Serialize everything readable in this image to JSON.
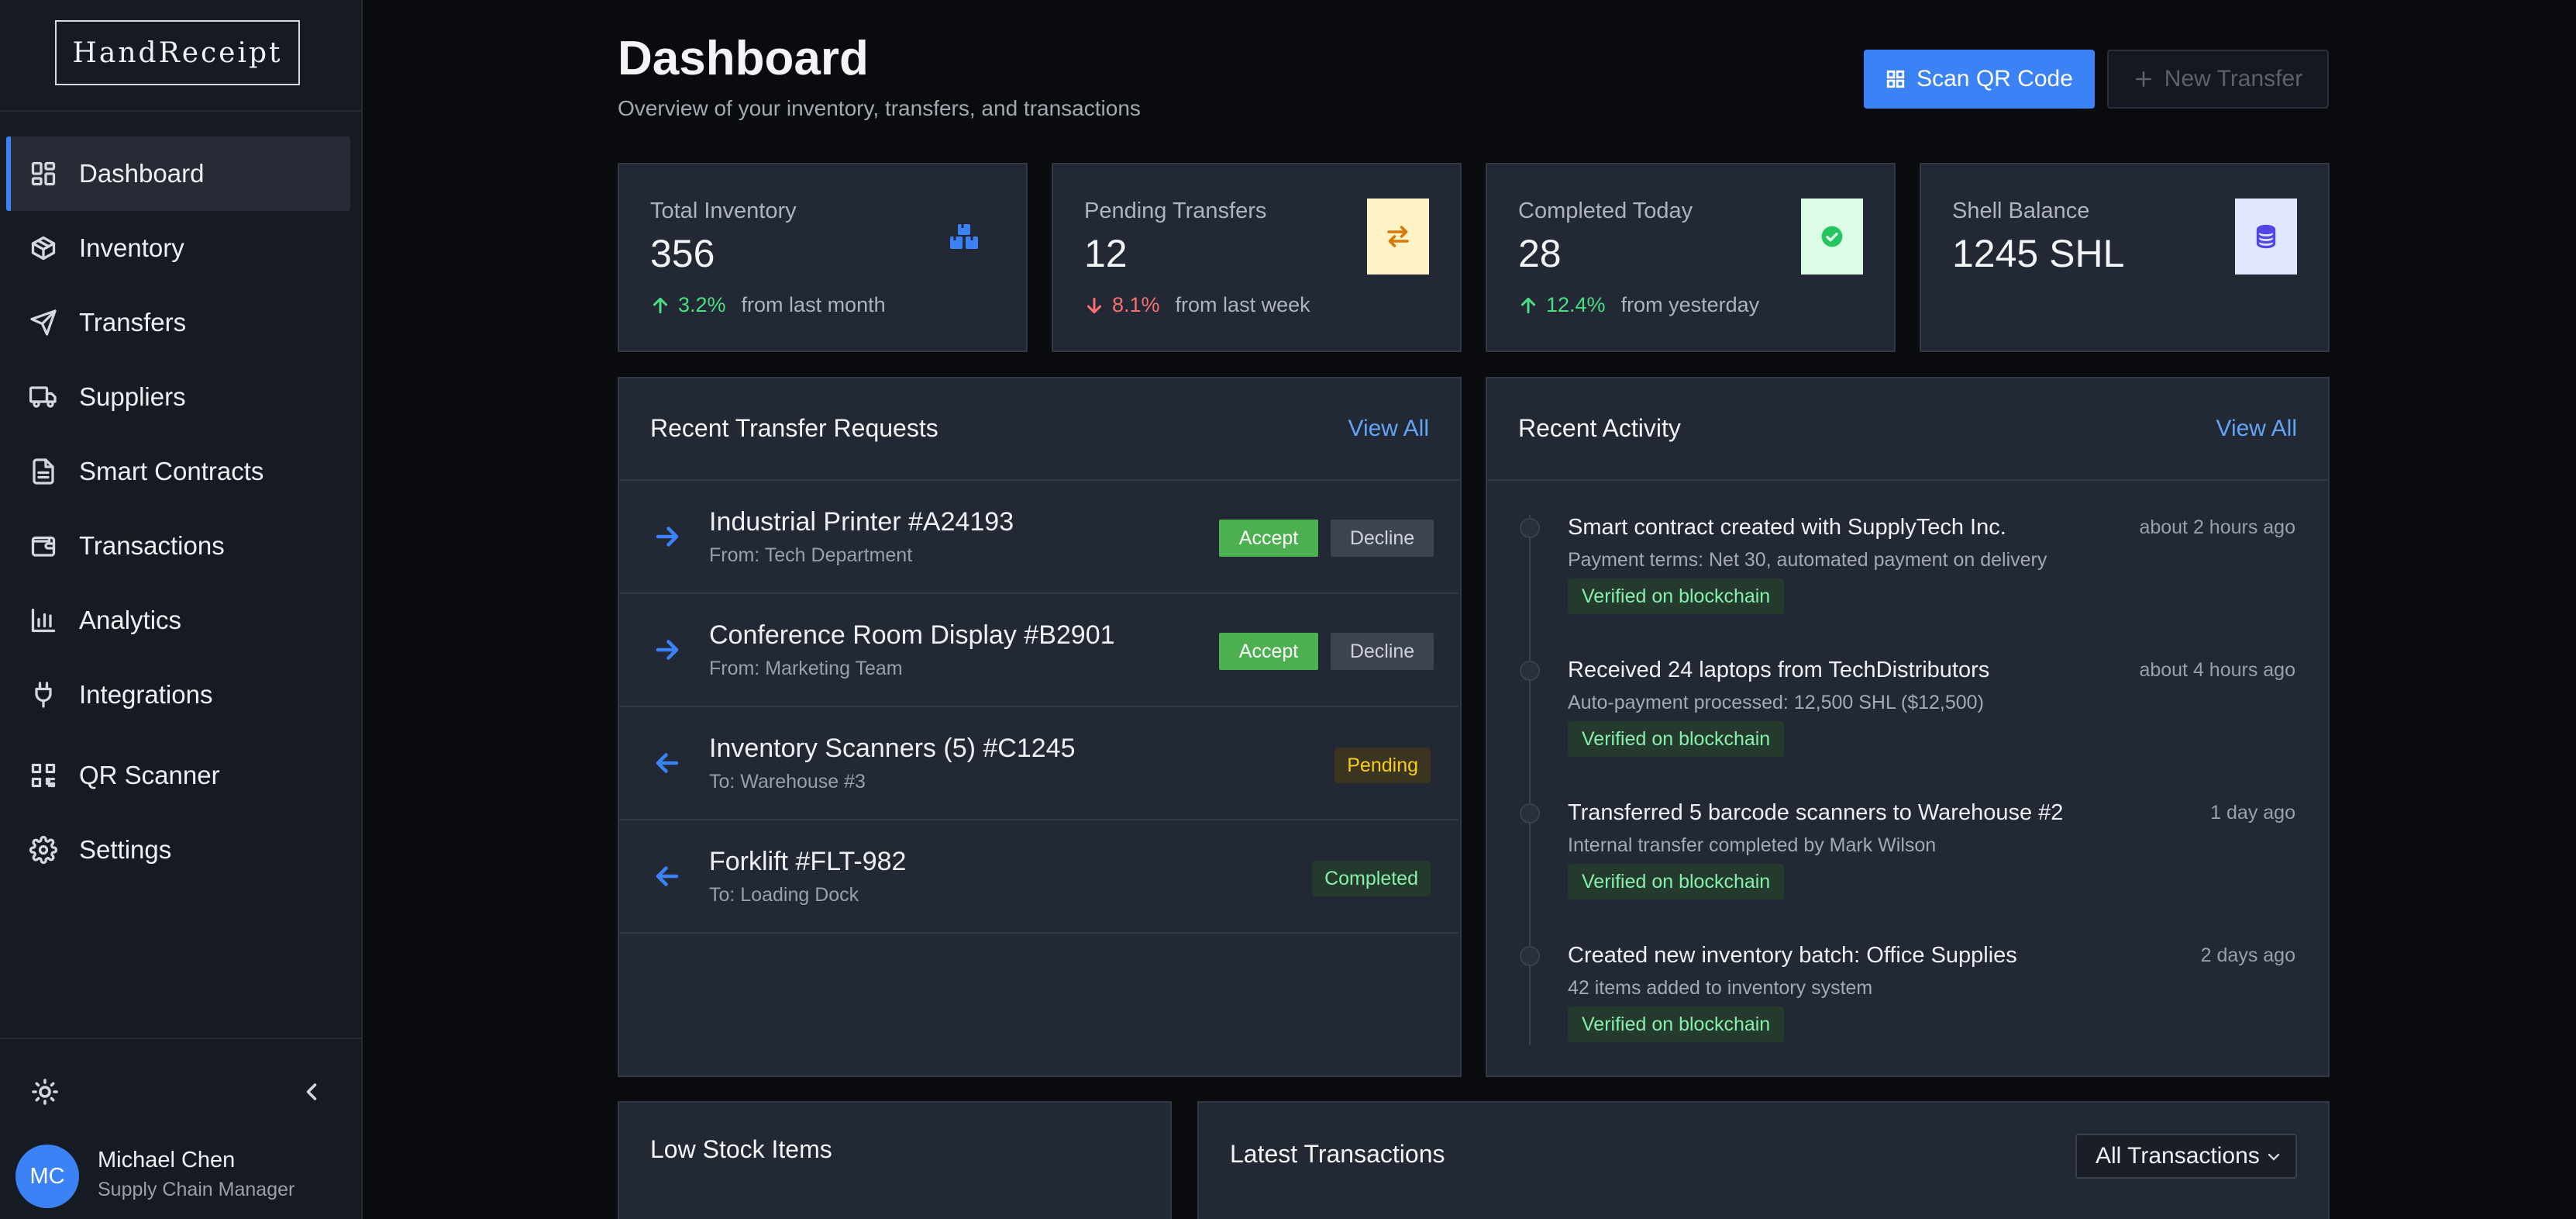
{
  "brand": "HandReceipt",
  "sidebar": {
    "items": [
      {
        "label": "Dashboard",
        "icon": "dashboard-icon",
        "active": true
      },
      {
        "label": "Inventory",
        "icon": "package-icon"
      },
      {
        "label": "Transfers",
        "icon": "send-icon"
      },
      {
        "label": "Suppliers",
        "icon": "truck-icon"
      },
      {
        "label": "Smart Contracts",
        "icon": "document-icon"
      },
      {
        "label": "Transactions",
        "icon": "wallet-icon"
      },
      {
        "label": "Analytics",
        "icon": "bar-chart-icon"
      },
      {
        "label": "Integrations",
        "icon": "plug-icon"
      },
      {
        "label": "QR Scanner",
        "icon": "qr-code-icon"
      },
      {
        "label": "Settings",
        "icon": "gear-icon"
      }
    ]
  },
  "user": {
    "initials": "MC",
    "name": "Michael Chen",
    "role": "Supply Chain Manager"
  },
  "header": {
    "title": "Dashboard",
    "subtitle": "Overview of your inventory, transfers, and transactions",
    "scan_label": "Scan QR Code",
    "new_transfer_label": "New Transfer"
  },
  "stats": [
    {
      "label": "Total Inventory",
      "value": "356",
      "change": "3.2%",
      "direction": "up",
      "ref": "from last month"
    },
    {
      "label": "Pending Transfers",
      "value": "12",
      "change": "8.1%",
      "direction": "down",
      "ref": "from last week"
    },
    {
      "label": "Completed Today",
      "value": "28",
      "change": "12.4%",
      "direction": "up",
      "ref": "from yesterday"
    },
    {
      "label": "Shell Balance",
      "value": "1245 SHL"
    }
  ],
  "transfers": {
    "title": "Recent Transfer Requests",
    "view_all": "View All",
    "accept_label": "Accept",
    "decline_label": "Decline",
    "rows": [
      {
        "name": "Industrial Printer #A24193",
        "sub": "From: Tech Department",
        "dir": "incoming"
      },
      {
        "name": "Conference Room Display #B2901",
        "sub": "From: Marketing Team",
        "dir": "incoming"
      },
      {
        "name": "Inventory Scanners (5) #C1245",
        "sub": "To: Warehouse #3",
        "dir": "outgoing",
        "status": "Pending"
      },
      {
        "name": "Forklift #FLT-982",
        "sub": "To: Loading Dock",
        "dir": "outgoing",
        "status": "Completed"
      }
    ]
  },
  "activity": {
    "title": "Recent Activity",
    "view_all": "View All",
    "items": [
      {
        "title": "Smart contract created with SupplyTech Inc.",
        "time": "about 2 hours ago",
        "desc": "Payment terms: Net 30, automated payment on delivery",
        "badge": "Verified on blockchain"
      },
      {
        "title": "Received 24 laptops from TechDistributors",
        "time": "about 4 hours ago",
        "desc": "Auto-payment processed: 12,500 SHL ($12,500)",
        "badge": "Verified on blockchain"
      },
      {
        "title": "Transferred 5 barcode scanners to Warehouse #2",
        "time": "1 day ago",
        "desc": "Internal transfer completed by Mark Wilson",
        "badge": "Verified on blockchain"
      },
      {
        "title": "Created new inventory batch: Office Supplies",
        "time": "2 days ago",
        "desc": "42 items added to inventory system",
        "badge": "Verified on blockchain"
      }
    ]
  },
  "low_stock": {
    "title": "Low Stock Items"
  },
  "latest_tx": {
    "title": "Latest Transactions",
    "filter": "All Transactions"
  },
  "colors": {
    "accent": "#3b82f6",
    "success": "#4ade80",
    "danger": "#f87171",
    "warning": "#facc15"
  }
}
